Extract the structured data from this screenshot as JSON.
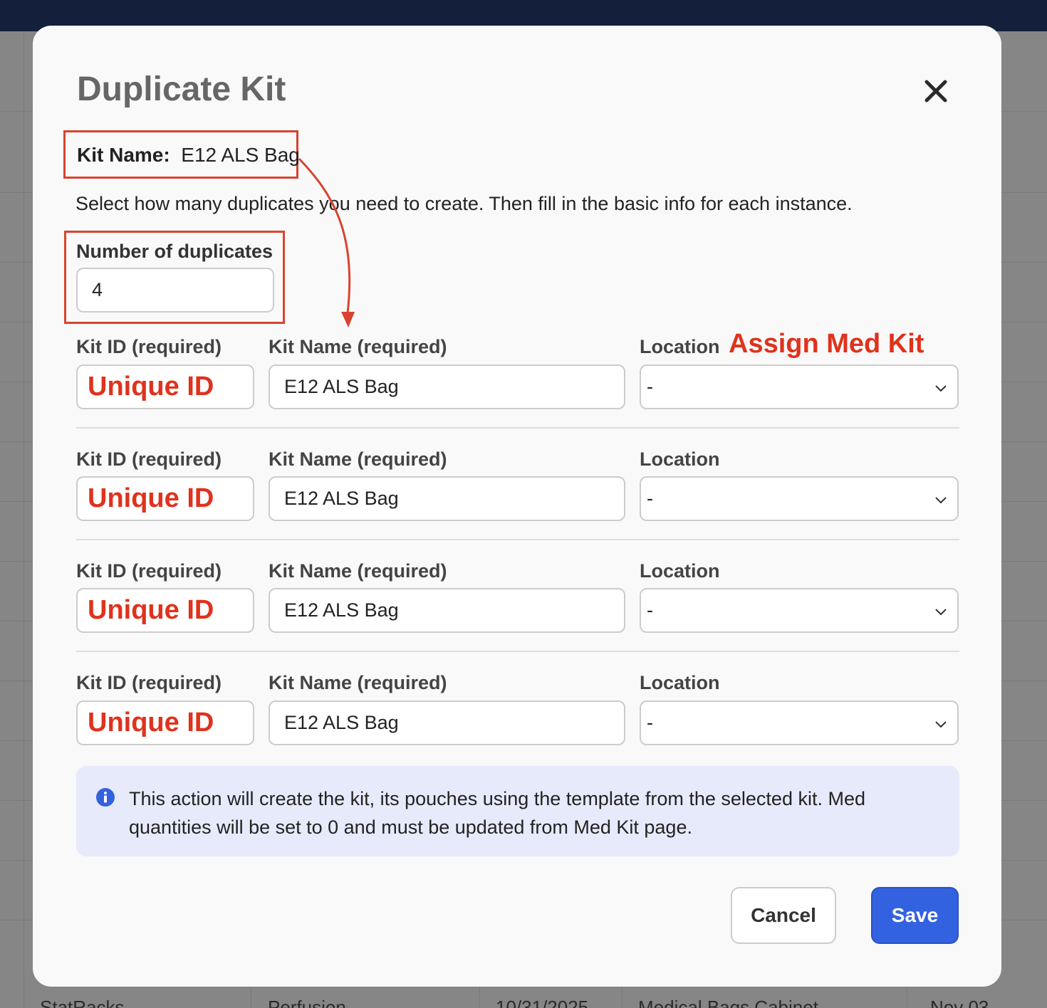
{
  "background": {
    "partial_cells": [
      "StatRacks",
      "Perfusion",
      "10/31/2025",
      "Medical Bags Cabinet",
      "Nov 03"
    ]
  },
  "modal": {
    "title": "Duplicate Kit",
    "kit_name_label": "Kit Name:",
    "kit_name_value": "E12 ALS Bag",
    "instructions": "Select how many duplicates you need to create. Then fill in the basic info for each instance.",
    "duplicates_label": "Number of duplicates",
    "duplicates_value": "4",
    "annotation_assign": "Assign Med Kit",
    "rows": [
      {
        "kit_id_label": "Kit ID (required)",
        "kit_id_value": "Unique ID",
        "kit_name_label": "Kit Name (required)",
        "kit_name_value": "E12 ALS Bag",
        "location_label": "Location",
        "location_value": "-"
      },
      {
        "kit_id_label": "Kit ID (required)",
        "kit_id_value": "Unique ID",
        "kit_name_label": "Kit Name (required)",
        "kit_name_value": "E12 ALS Bag",
        "location_label": "Location",
        "location_value": "-"
      },
      {
        "kit_id_label": "Kit ID (required)",
        "kit_id_value": "Unique ID",
        "kit_name_label": "Kit Name (required)",
        "kit_name_value": "E12 ALS Bag",
        "location_label": "Location",
        "location_value": "-"
      },
      {
        "kit_id_label": "Kit ID (required)",
        "kit_id_value": "Unique ID",
        "kit_name_label": "Kit Name (required)",
        "kit_name_value": "E12 ALS Bag",
        "location_label": "Location",
        "location_value": "-"
      }
    ],
    "info_text": "This action will create the kit, its pouches using the template from the selected kit. Med quantities will be set to 0 and must be updated from Med Kit page.",
    "cancel_label": "Cancel",
    "save_label": "Save"
  },
  "icons": {
    "close": "close-icon",
    "info": "info-icon",
    "chevron": "chevron-down-icon"
  },
  "colors": {
    "annotation": "#d9432f",
    "primary": "#3362e0",
    "info_bg": "#e7eafb",
    "topbar": "#141f3c"
  }
}
